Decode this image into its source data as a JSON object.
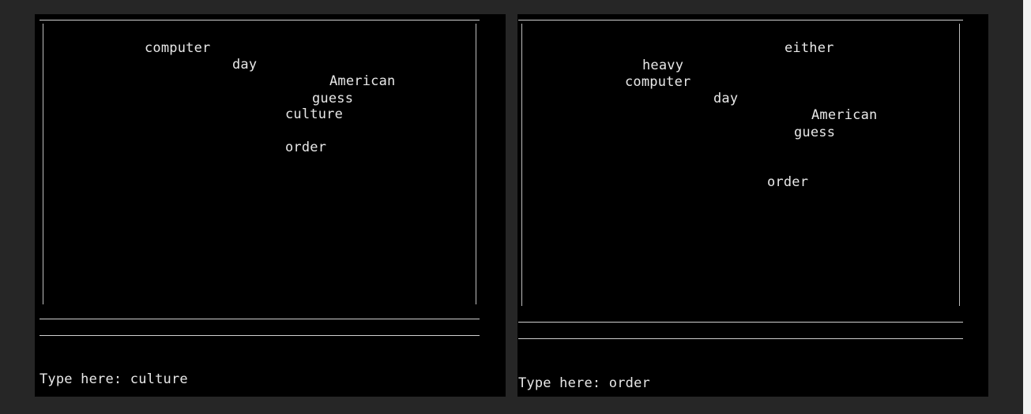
{
  "left_panel": {
    "words": [
      {
        "text": "computer"
      },
      {
        "text": "day"
      },
      {
        "text": "American"
      },
      {
        "text": "guess"
      },
      {
        "text": "culture"
      },
      {
        "text": "order"
      }
    ],
    "prompt_label": "Type here: ",
    "input_value": "culture"
  },
  "right_panel": {
    "words": [
      {
        "text": "either"
      },
      {
        "text": "heavy"
      },
      {
        "text": "computer"
      },
      {
        "text": "day"
      },
      {
        "text": "American"
      },
      {
        "text": "guess"
      },
      {
        "text": "order"
      }
    ],
    "prompt_label": "Type here: ",
    "input_value": "order"
  }
}
